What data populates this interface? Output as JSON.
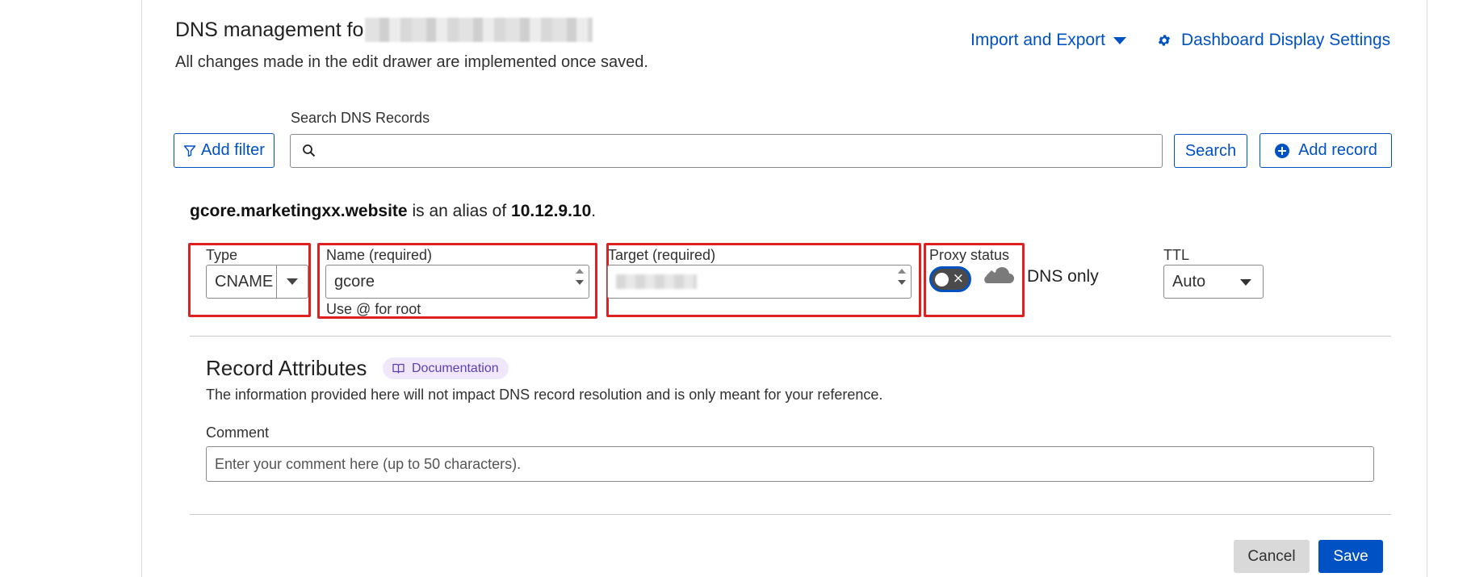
{
  "header": {
    "title": "DNS management fo",
    "subtitle": "All changes made in the edit drawer are implemented once saved.",
    "import_export_label": "Import and Export",
    "display_settings_label": "Dashboard Display Settings"
  },
  "toolbar": {
    "add_filter_label": "Add filter",
    "search_label": "Search DNS Records",
    "search_placeholder": "",
    "search_button_label": "Search",
    "add_record_label": "Add record"
  },
  "alias": {
    "hostname": "gcore.marketingxx.website",
    "middle_text": " is an alias of ",
    "target_ip": "10.12.9.10",
    "end_text": "."
  },
  "record_form": {
    "type_label": "Type",
    "type_value": "CNAME",
    "name_label": "Name (required)",
    "name_value": "gcore",
    "name_hint": "Use @ for root",
    "target_label": "Target (required)",
    "proxy_label": "Proxy status",
    "proxy_state": "off",
    "proxy_text": "DNS only",
    "ttl_label": "TTL",
    "ttl_value": "Auto"
  },
  "attributes": {
    "title": "Record Attributes",
    "doc_badge_label": "Documentation",
    "description": "The information provided here will not impact DNS record resolution and is only meant for your reference.",
    "comment_label": "Comment",
    "comment_placeholder": "Enter your comment here (up to 50 characters)."
  },
  "actions": {
    "cancel_label": "Cancel",
    "save_label": "Save"
  },
  "colors": {
    "accent": "#0051c3",
    "highlight_box": "#e02020",
    "badge_bg": "#eee8fa",
    "badge_text": "#5d3fb5"
  }
}
